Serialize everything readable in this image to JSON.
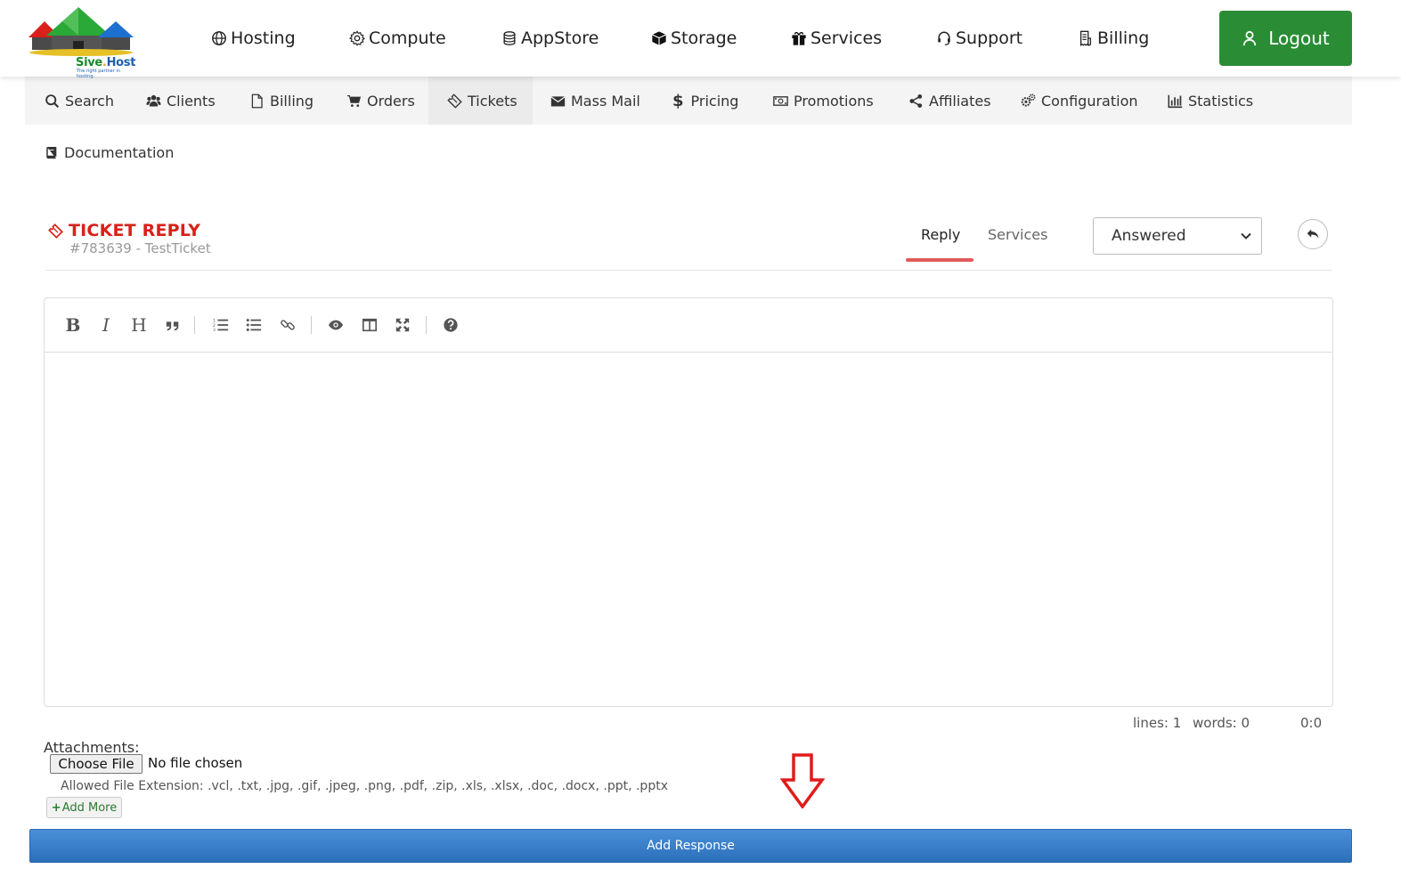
{
  "brand": {
    "name_part1": "Sive",
    "name_dot": ".",
    "name_part2": "Host",
    "tagline": "The right partner in hosting."
  },
  "topnav": {
    "items": [
      {
        "label": "Hosting",
        "icon": "globe-icon"
      },
      {
        "label": "Compute",
        "icon": "gear-icon"
      },
      {
        "label": "AppStore",
        "icon": "database-icon"
      },
      {
        "label": "Storage",
        "icon": "box-icon"
      },
      {
        "label": "Services",
        "icon": "gift-icon"
      },
      {
        "label": "Support",
        "icon": "headset-icon"
      },
      {
        "label": "Billing",
        "icon": "receipt-icon"
      }
    ],
    "logout_label": "Logout"
  },
  "subnav": {
    "items": [
      {
        "label": "Search",
        "icon": "search-icon"
      },
      {
        "label": "Clients",
        "icon": "users-icon"
      },
      {
        "label": "Billing",
        "icon": "file-icon"
      },
      {
        "label": "Orders",
        "icon": "cart-icon"
      },
      {
        "label": "Tickets",
        "icon": "ticket-icon",
        "active": true
      },
      {
        "label": "Mass Mail",
        "icon": "envelope-icon"
      },
      {
        "label": "Pricing",
        "icon": "dollar-icon"
      },
      {
        "label": "Promotions",
        "icon": "money-icon"
      },
      {
        "label": "Affiliates",
        "icon": "share-icon"
      },
      {
        "label": "Configuration",
        "icon": "cogs-icon"
      },
      {
        "label": "Statistics",
        "icon": "bar-chart-icon"
      }
    ],
    "documentation_label": "Documentation"
  },
  "ticket": {
    "title": "TICKET REPLY",
    "subtitle": "#783639 - TestTicket",
    "tabs": {
      "reply": "Reply",
      "services": "Services"
    },
    "status_selected": "Answered"
  },
  "editor": {
    "lines_label": "lines: 1",
    "words_label": "words: 0",
    "cursor_label": "0:0"
  },
  "attachments": {
    "label": "Attachments:",
    "choose_file": "Choose File",
    "file_status": "No file chosen",
    "allowed_extensions": "Allowed File Extension: .vcl, .txt, .jpg, .gif, .jpeg, .png, .pdf, .zip, .xls, .xlsx, .doc, .docx, .ppt, .pptx",
    "add_more": "Add More"
  },
  "submit_label": "Add Response",
  "colors": {
    "brand_green": "#2a8c35",
    "ticket_red": "#d9201a",
    "primary_blue": "#2b6fba",
    "tab_underline": "#e05a5a"
  }
}
